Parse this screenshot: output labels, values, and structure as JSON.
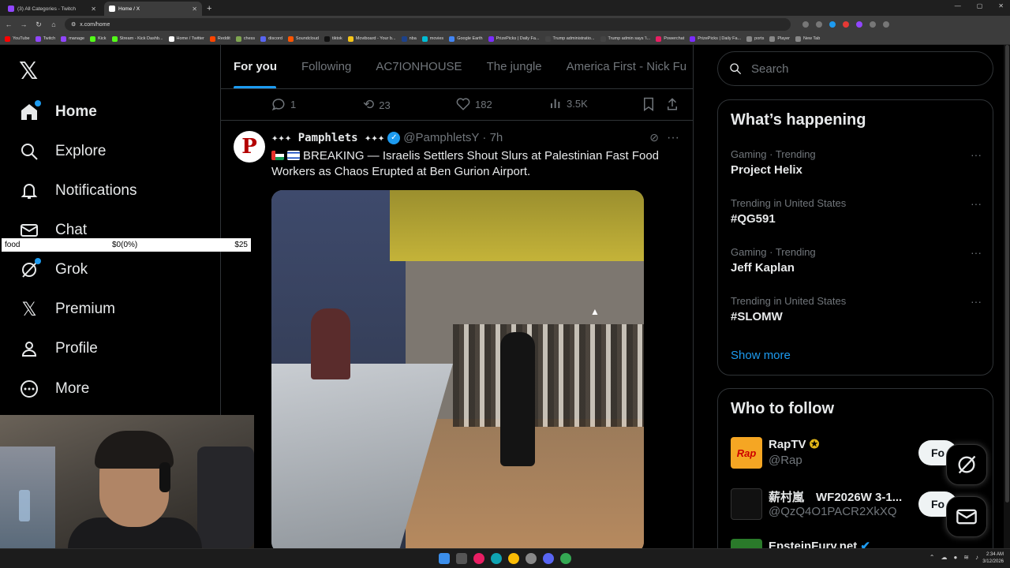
{
  "browser": {
    "tabs": [
      {
        "title": "(3) All Categories - Twitch",
        "color": "#9146ff",
        "active": false
      },
      {
        "title": "Home / X",
        "color": "#ffffff",
        "active": true
      }
    ],
    "url": "x.com/home",
    "bookmarks": [
      {
        "label": "YouTube",
        "color": "#ff0000"
      },
      {
        "label": "Twitch",
        "color": "#9146ff"
      },
      {
        "label": "manage",
        "color": "#9146ff"
      },
      {
        "label": "Kick",
        "color": "#53fc18"
      },
      {
        "label": "Stream - Kick Dashb...",
        "color": "#53fc18"
      },
      {
        "label": "Home / Twitter",
        "color": "#ffffff"
      },
      {
        "label": "Reddit",
        "color": "#ff4500"
      },
      {
        "label": "chess",
        "color": "#7fa650"
      },
      {
        "label": "discord",
        "color": "#5865f2"
      },
      {
        "label": "Soundcloud",
        "color": "#ff5500"
      },
      {
        "label": "tiktok",
        "color": "#111111"
      },
      {
        "label": "Moviboard - Your b...",
        "color": "#f5c518"
      },
      {
        "label": "nba",
        "color": "#1d428a"
      },
      {
        "label": "movies",
        "color": "#00bcd4"
      },
      {
        "label": "Google Earth",
        "color": "#4285f4"
      },
      {
        "label": "PrizePicks | Daily Fa...",
        "color": "#7b2cff"
      },
      {
        "label": "Trump administratio...",
        "color": "#444444"
      },
      {
        "label": "Trump admin says 'I...",
        "color": "#444444"
      },
      {
        "label": "Powerchat",
        "color": "#e91e63"
      },
      {
        "label": "PrizePicks | Daily Fa...",
        "color": "#7b2cff"
      },
      {
        "label": "ports",
        "color": "#888888"
      },
      {
        "label": "Player",
        "color": "#888888"
      },
      {
        "label": "New Tab",
        "color": "#888888"
      }
    ]
  },
  "nav": {
    "items": [
      {
        "label": "Home",
        "icon": "home-icon",
        "active": true,
        "dot": true
      },
      {
        "label": "Explore",
        "icon": "search-icon"
      },
      {
        "label": "Notifications",
        "icon": "bell-icon"
      },
      {
        "label": "Chat",
        "icon": "mail-icon"
      },
      {
        "label": "Grok",
        "icon": "grok-icon",
        "dot": true
      },
      {
        "label": "Premium",
        "icon": "x-icon"
      },
      {
        "label": "Profile",
        "icon": "person-icon"
      },
      {
        "label": "More",
        "icon": "more-circle-icon"
      }
    ]
  },
  "overlay": {
    "label": "food",
    "value": "$0(0%)",
    "goal": "$25"
  },
  "feed_tabs": [
    "For you",
    "Following",
    "AC7IONHOUSE",
    "The jungle",
    "America First - Nick Fu"
  ],
  "prev_actions": {
    "replies": "1",
    "reposts": "23",
    "likes": "182",
    "views": "3.5K"
  },
  "tweet": {
    "avatar_letter": "P",
    "name": "✦✦✦ Pamphlets ✦✦✦",
    "handle": "@PamphletsY",
    "time": "· 7h",
    "text": "BREAKING — Israelis Settlers Shout Slurs at Palestinian Fast Food Workers as Chaos Erupted at Ben Gurion Airport."
  },
  "search": {
    "placeholder": "Search"
  },
  "trending": {
    "title": "What’s happening",
    "items": [
      {
        "meta": "Gaming · Trending",
        "topic": "Project Helix"
      },
      {
        "meta": "Trending in United States",
        "topic": "#QG591"
      },
      {
        "meta": "Gaming · Trending",
        "topic": "Jeff Kaplan"
      },
      {
        "meta": "Trending in United States",
        "topic": "#SLOMW"
      }
    ],
    "show_more": "Show more"
  },
  "who_to_follow": {
    "title": "Who to follow",
    "items": [
      {
        "name": "RapTV",
        "handle": "@Rap",
        "color": "#f5a623",
        "verified": true,
        "button": "Fo"
      },
      {
        "name": "薪村嵐　WF2026W 3-1...",
        "handle": "@QzQ4O1PACR2XkXQ",
        "color": "#222222",
        "verified": false,
        "button": "Fo"
      },
      {
        "name": "EpsteinFury.net",
        "handle": "",
        "color": "#2a7a2a",
        "verified": true,
        "button": ""
      }
    ]
  },
  "clock": {
    "time": "2:34 AM",
    "date": "3/12/2026"
  },
  "colors": {
    "accent": "#1d9bf0",
    "bg": "#000000",
    "border": "#2f3336"
  }
}
